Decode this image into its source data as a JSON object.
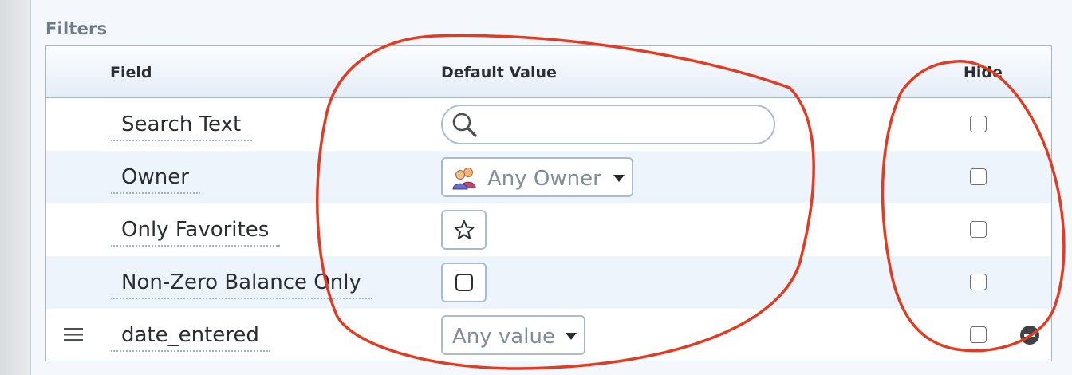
{
  "section_title": "Filters",
  "columns": {
    "field": "Field",
    "default_value": "Default Value",
    "hide": "Hide"
  },
  "rows": [
    {
      "label": "Search Text",
      "control": "search",
      "search_value": "",
      "hidden": false
    },
    {
      "label": "Owner",
      "control": "owner-select",
      "selected": "Any Owner",
      "icon": "users-icon",
      "hidden": false
    },
    {
      "label": "Only Favorites",
      "control": "star-toggle",
      "icon": "star-outline-icon",
      "hidden": false
    },
    {
      "label": "Non-Zero Balance Only",
      "control": "checkbox-toggle",
      "icon": "empty-checkbox-icon",
      "hidden": false
    },
    {
      "label": "date_entered",
      "control": "value-select",
      "selected": "Any value",
      "hidden": false,
      "draggable": true,
      "removable": true,
      "drag_icon": "drag-handle-icon",
      "remove_icon": "remove-circle-icon"
    }
  ],
  "colors": {
    "panel_bg": "#f4f8fc",
    "alt_row_bg": "#eef4fb",
    "border": "#a9b5c2",
    "control_border": "#a9bccd",
    "annotation_stroke": "#e23b22"
  }
}
